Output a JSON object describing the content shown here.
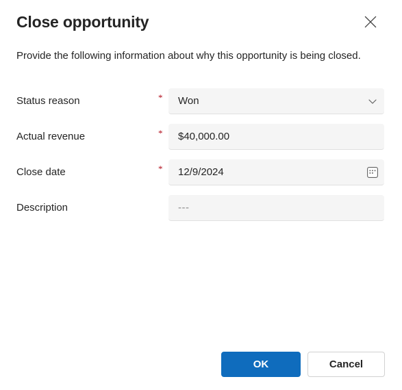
{
  "dialog": {
    "title": "Close opportunity",
    "subtitle": "Provide the following information about why this opportunity is being closed.",
    "close_icon": "close-icon",
    "accent_color": "#0f6cbd",
    "required_marker": "*",
    "required_marker_color": "#b10e1c",
    "field_background": "#f5f5f5",
    "text_color": "#242424"
  },
  "fields": [
    {
      "label": "Status reason",
      "required": true,
      "value": "Won",
      "control": "dropdown",
      "icon": "chevron-down-icon",
      "placeholder": ""
    },
    {
      "label": "Actual revenue",
      "required": true,
      "value": "$40,000.00",
      "control": "text",
      "icon": "",
      "placeholder": ""
    },
    {
      "label": "Close date",
      "required": true,
      "value": "12/9/2024",
      "control": "date",
      "icon": "calendar-icon",
      "placeholder": ""
    },
    {
      "label": "Description",
      "required": false,
      "value": "---",
      "control": "text",
      "icon": "",
      "placeholder": "---"
    }
  ],
  "footer": {
    "ok_label": "OK",
    "cancel_label": "Cancel"
  }
}
